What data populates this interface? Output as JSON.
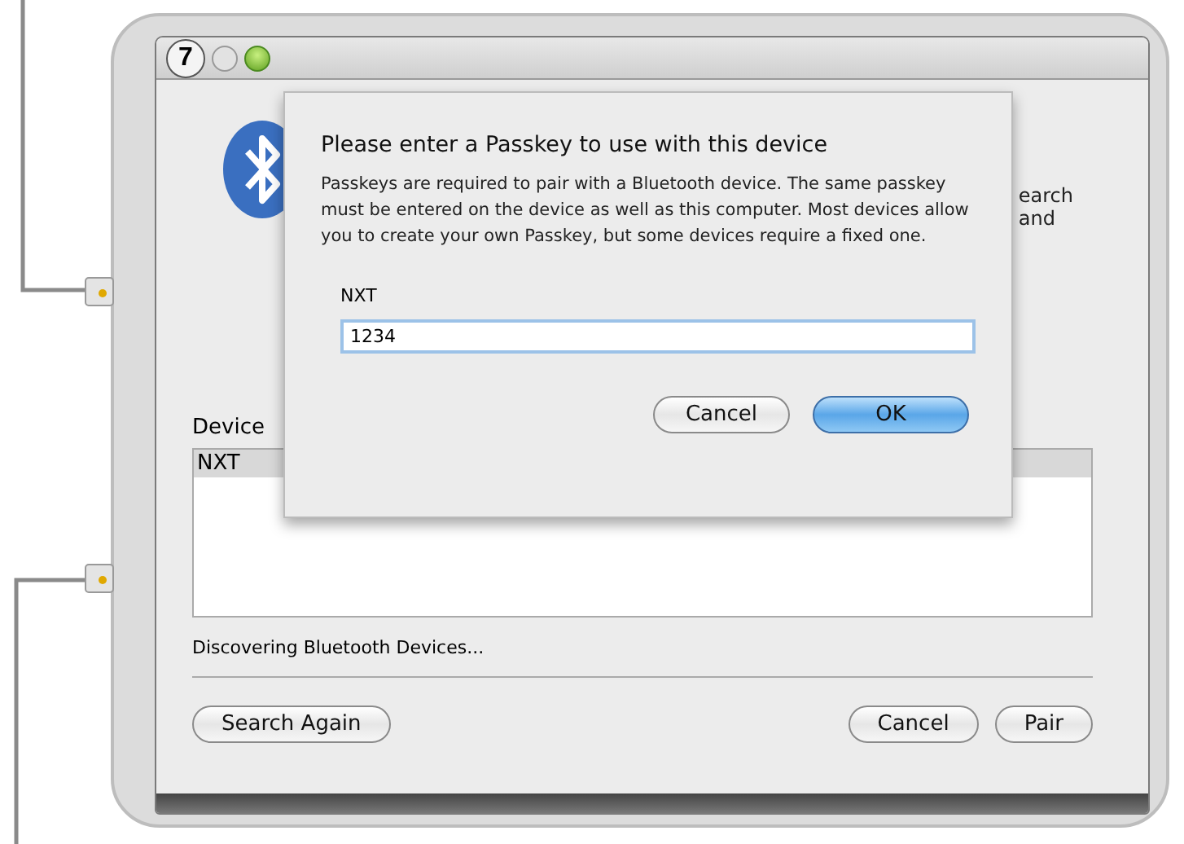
{
  "badge": "7",
  "window": {
    "partial_text": [
      "earch",
      "and"
    ],
    "device_label": "Device",
    "devices": [
      {
        "name": "NXT",
        "selected": true
      }
    ],
    "status": "Discovering Bluetooth Devices...",
    "buttons": [
      {
        "label": "Search Again"
      },
      {
        "label": "Cancel"
      },
      {
        "label": "Pair"
      }
    ]
  },
  "sheet": {
    "title": "Please enter a Passkey to use with this device",
    "message": "Passkeys are required to pair with a Bluetooth device.  The same passkey must be entered on the device as well as this computer. Most devices allow you to create your own Passkey, but some devices require a fixed one.",
    "field_label": "NXT",
    "field_value": "1234",
    "buttons": [
      {
        "label": "Cancel",
        "default": false
      },
      {
        "label": "OK",
        "default": true
      }
    ]
  }
}
